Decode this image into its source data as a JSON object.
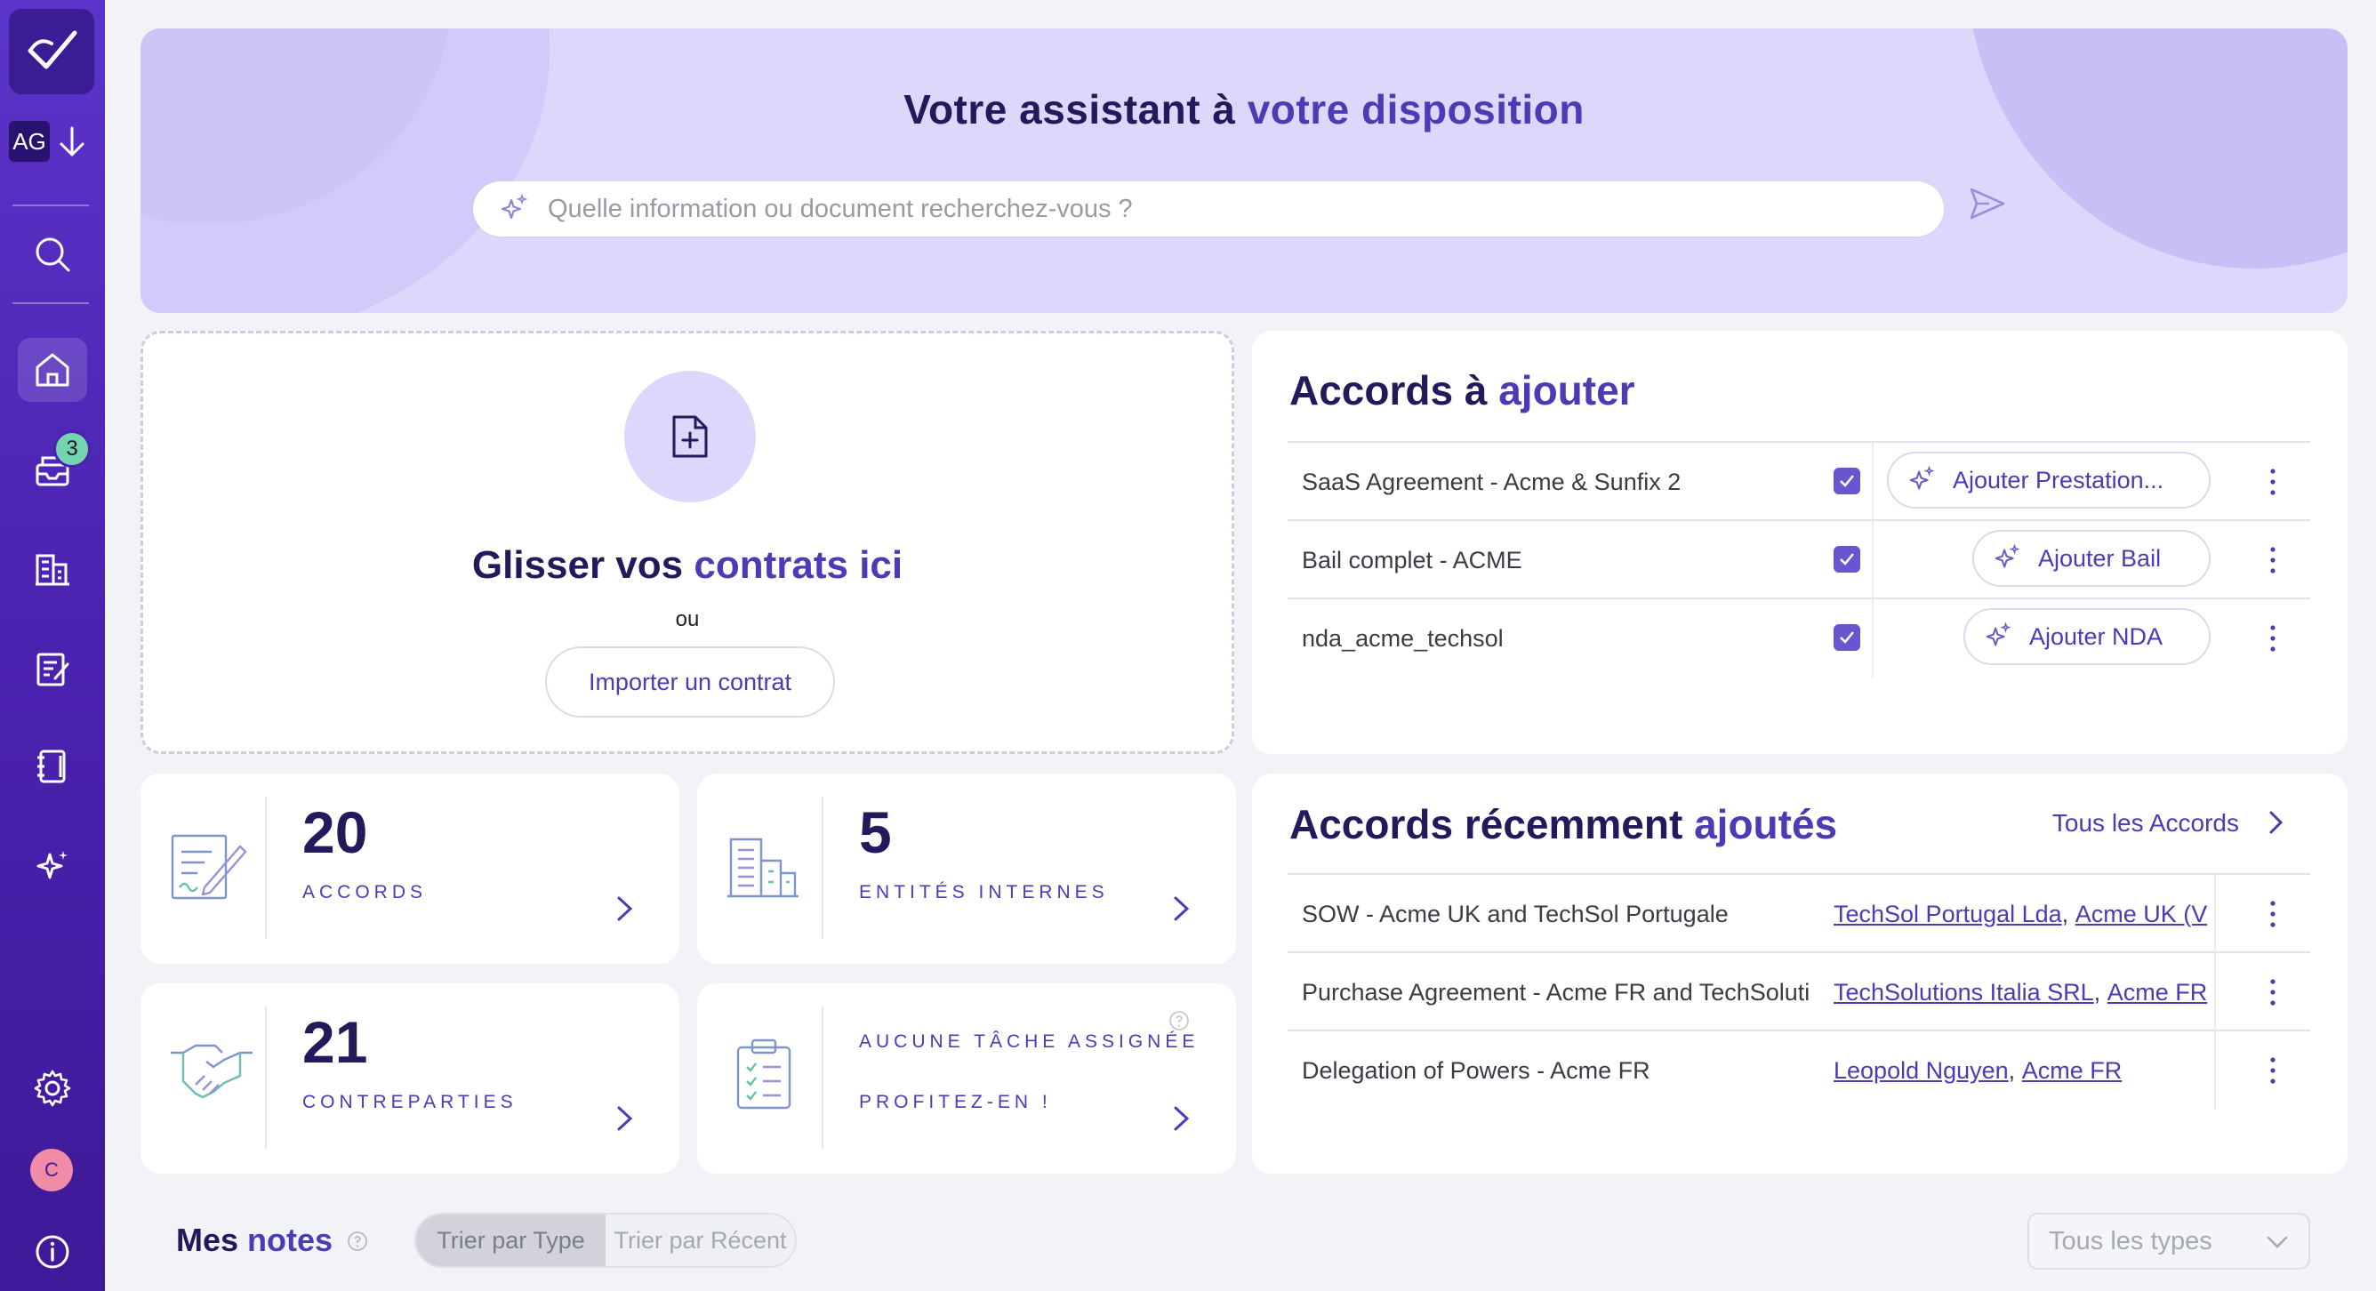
{
  "sidebar": {
    "workspace": "AG",
    "inbox_badge": "3",
    "avatar_initial": "C"
  },
  "banner": {
    "title_part1": "Votre assistant à",
    "title_part2": "votre disposition",
    "search_placeholder": "Quelle information ou document recherchez-vous ?"
  },
  "dropzone": {
    "title_part1": "Glisser vos",
    "title_part2": "contrats ici",
    "or": "ou",
    "import_label": "Importer un contrat"
  },
  "to_add": {
    "title_part1": "Accords à",
    "title_part2": "ajouter",
    "rows": [
      {
        "name": "SaaS Agreement - Acme & Sunfix 2",
        "action": "Ajouter Prestation..."
      },
      {
        "name": "Bail complet - ACME",
        "action": "Ajouter Bail"
      },
      {
        "name": "nda_acme_techsol",
        "action": "Ajouter NDA"
      }
    ]
  },
  "recent": {
    "title_part1": "Accords récemment",
    "title_part2": "ajoutés",
    "all_link": "Tous les Accords",
    "rows": [
      {
        "name": "SOW - Acme UK and TechSol Portugale",
        "link1": "TechSol Portugal Lda",
        "link2": "Acme UK (V"
      },
      {
        "name": "Purchase Agreement - Acme FR and TechSoluti",
        "link1": "TechSolutions Italia SRL",
        "link2": "Acme FR"
      },
      {
        "name": "Delegation of Powers - Acme FR",
        "link1": "Leopold Nguyen",
        "link2": "Acme FR"
      }
    ]
  },
  "stats": {
    "accords_count": "20",
    "accords_label": "ACCORDS",
    "entites_count": "5",
    "entites_label": "ENTITÉS INTERNES",
    "contreparties_count": "21",
    "contreparties_label": "CONTREPARTIES",
    "tasks_line1": "AUCUNE TÂCHE ASSIGNÉE",
    "tasks_line2": "PROFITEZ-EN !"
  },
  "notes": {
    "title_part1": "Mes",
    "title_part2": "notes",
    "sort_type": "Trier par Type",
    "sort_recent": "Trier par Récent",
    "filter_value": "Tous les types"
  },
  "colors": {
    "sidebar": "#4a22b0",
    "accent": "#4b3bb5",
    "banner": "#ddd7fb",
    "heading": "#231a5c"
  }
}
